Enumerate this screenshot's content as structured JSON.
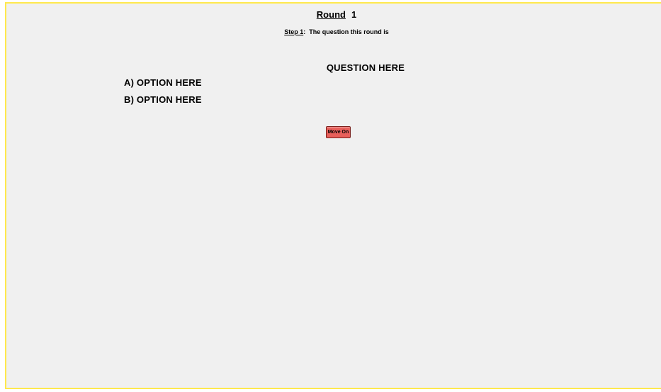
{
  "round": {
    "label": "Round",
    "number": "1"
  },
  "step": {
    "label": "Step 1",
    "separator": ":",
    "text": "The question this round is"
  },
  "question": {
    "text": "QUESTION HERE"
  },
  "options": [
    {
      "text": "A) OPTION HERE"
    },
    {
      "text": "B) OPTION HERE"
    }
  ],
  "actions": {
    "move_on_label": "Move On",
    "move_on_color": "#e8605b"
  },
  "colors": {
    "frame_border": "#ffe94d",
    "background": "#f0f0f0"
  }
}
